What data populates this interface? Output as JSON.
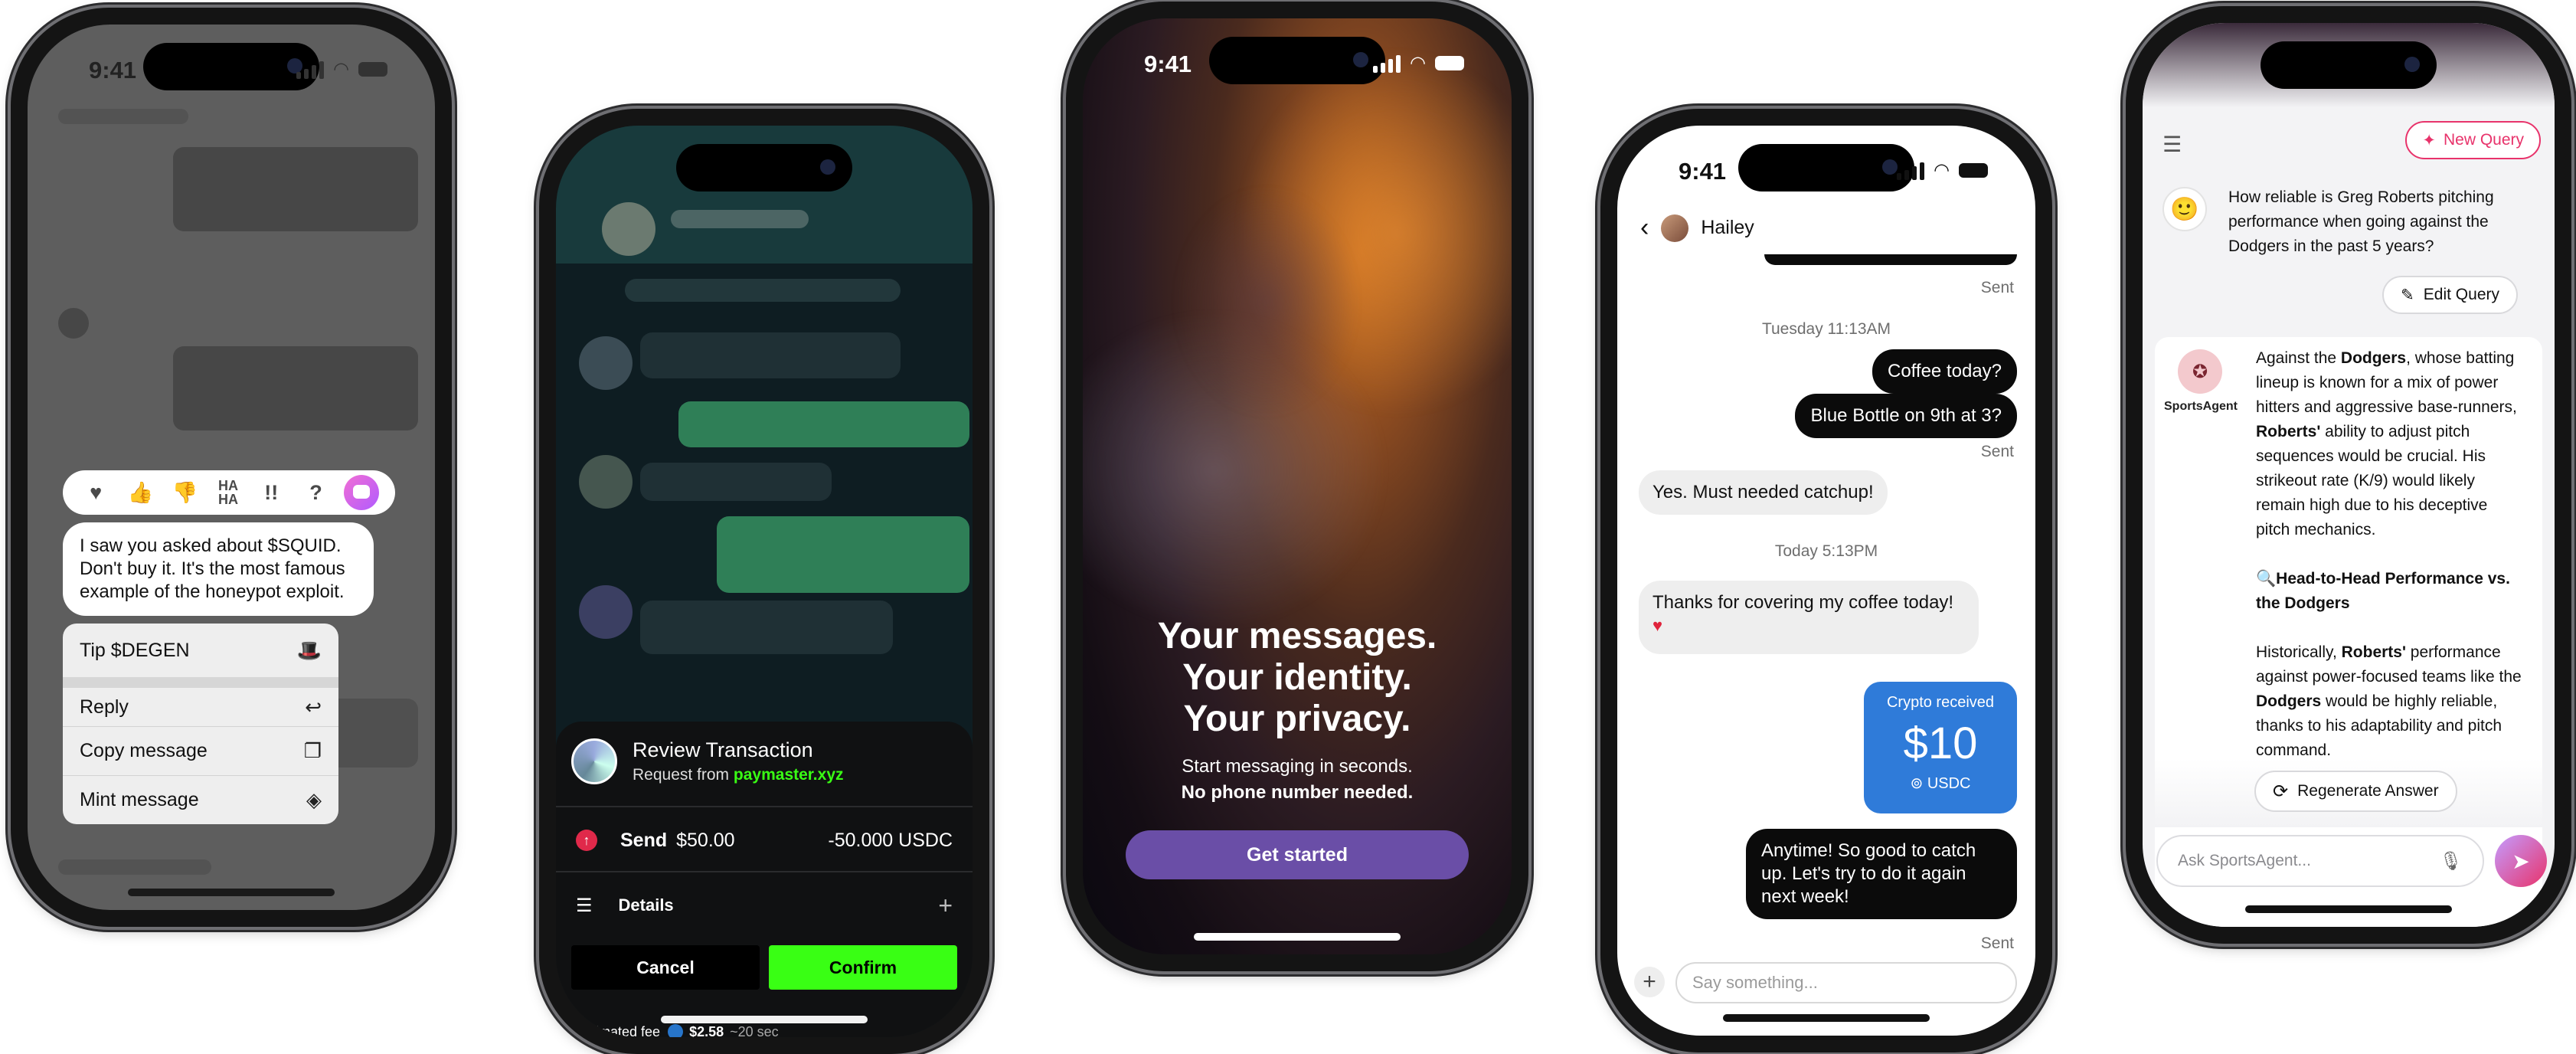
{
  "phone1": {
    "status_time": "9:41",
    "reactions": [
      "♥",
      "👍",
      "👎",
      "HA HA",
      "!!",
      "?"
    ],
    "message": "I saw you asked about $SQUID. Don't buy it. It's the most famous example of the honeypot exploit.",
    "menu": [
      {
        "label": "Tip $DEGEN",
        "icon": "hat-icon"
      },
      {
        "label": "Reply",
        "icon": "reply-icon"
      },
      {
        "label": "Copy message",
        "icon": "copy-icon"
      },
      {
        "label": "Mint message",
        "icon": "diamond-icon"
      }
    ]
  },
  "phone2": {
    "sheet_title": "Review Transaction",
    "request_prefix": "Request from",
    "request_domain": "paymaster.xyz",
    "send_label": "Send",
    "send_value": "$50.00",
    "send_amount": "-50.000 USDC",
    "details_label": "Details",
    "cancel_label": "Cancel",
    "confirm_label": "Confirm",
    "fee_label": "Estimated fee",
    "fee_value": "$2.58",
    "fee_time": "~20 sec",
    "accent": "#39ff14"
  },
  "phone3": {
    "status_time": "9:41",
    "hero_lines": [
      "Your messages.",
      "Your identity.",
      "Your privacy."
    ],
    "sub_line1": "Start messaging in seconds.",
    "sub_line2": "No phone number needed.",
    "cta": "Get started",
    "cta_color": "#6a4ea7"
  },
  "phone4": {
    "status_time": "9:41",
    "contact": "Hailey",
    "sent_label": "Sent",
    "ts1": "Tuesday 11:13AM",
    "msg_coffee": "Coffee today?",
    "msg_bottle": "Blue Bottle on 9th at 3?",
    "msg_catchup": "Yes. Must needed catchup!",
    "ts2": "Today 5:13PM",
    "msg_thanks": "Thanks for covering my coffee today!",
    "crypto_label": "Crypto received",
    "crypto_amount": "$10",
    "crypto_currency": "USDC",
    "msg_anytime": "Anytime! So good to catch up. Let's try to do it again next week!",
    "input_placeholder": "Say something...",
    "crypto_color": "#2f7bd9"
  },
  "phone5": {
    "new_query": "New Query",
    "question": "How reliable is Greg Roberts pitching performance when going against the Dodgers in the past 5 years?",
    "edit_query": "Edit Query",
    "agent_name": "SportsAgent",
    "answer": {
      "p1_a": "Against the ",
      "p1_b": "Dodgers",
      "p1_c": ", whose batting lineup is known for a mix of power hitters and aggressive base-runners, ",
      "p1_d": "Roberts'",
      "p1_e": " ability to adjust pitch sequences would be crucial. His strikeout rate (K/9) would likely remain high due to his deceptive pitch mechanics.",
      "heading": "Head-to-Head Performance vs. the Dodgers",
      "p2_a": "Historically, ",
      "p2_b": "Roberts'",
      "p2_c": " performance against power-focused teams like the ",
      "p2_d": "Dodgers",
      "p2_e": " would be highly reliable, thanks to his adaptability and pitch command."
    },
    "regenerate": "Regenerate Answer",
    "input_placeholder": "Ask SportsAgent...",
    "new_query_color": "#e8336b"
  }
}
